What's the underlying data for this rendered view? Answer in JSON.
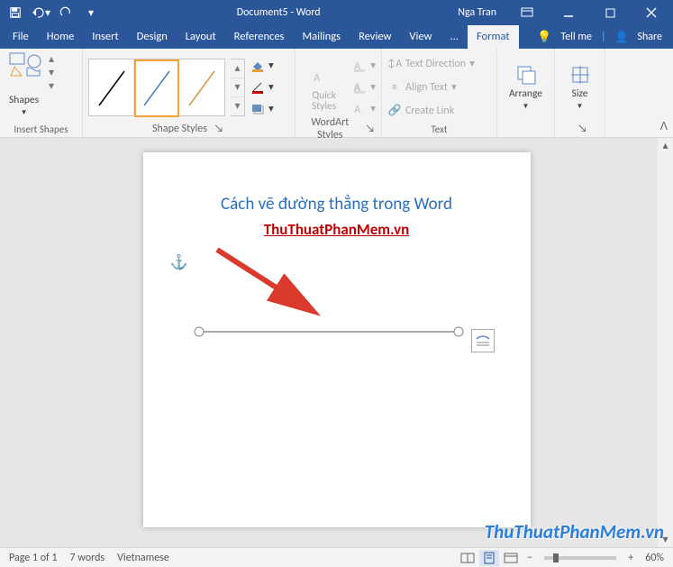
{
  "titlebar": {
    "document_name": "Document5",
    "app_name": "Word",
    "title_sep": " - ",
    "user_name": "Nga Tran"
  },
  "menu": {
    "file": "File",
    "home": "Home",
    "insert": "Insert",
    "design": "Design",
    "layout": "Layout",
    "references": "References",
    "mailings": "Mailings",
    "review": "Review",
    "view": "View",
    "addins": "...",
    "format": "Format",
    "tellme": "Tell me",
    "share": "Share"
  },
  "ribbon": {
    "insert_shapes": {
      "shapes_btn": "Shapes",
      "group_label": "Insert Shapes"
    },
    "shape_styles": {
      "group_label": "Shape Styles",
      "fill": "",
      "outline": "",
      "effects": ""
    },
    "wordart_styles": {
      "quick_styles": "Quick\nStyles",
      "group_label": "WordArt Styles"
    },
    "text": {
      "text_direction": "Text Direction",
      "align_text": "Align Text",
      "create_link": "Create Link",
      "group_label": "Text"
    },
    "arrange": {
      "arrange_btn": "Arrange",
      "group_label": ""
    },
    "size": {
      "size_btn": "Size",
      "group_label": ""
    }
  },
  "document": {
    "heading": "Cách vẽ đường thẳng trong Word",
    "link_text": "ThuThuatPhanMem.vn"
  },
  "watermark": "ThuThuatPhanMem.vn",
  "status": {
    "page": "Page 1 of 1",
    "words": "7 words",
    "language": "Vietnamese",
    "zoom": "60%"
  }
}
